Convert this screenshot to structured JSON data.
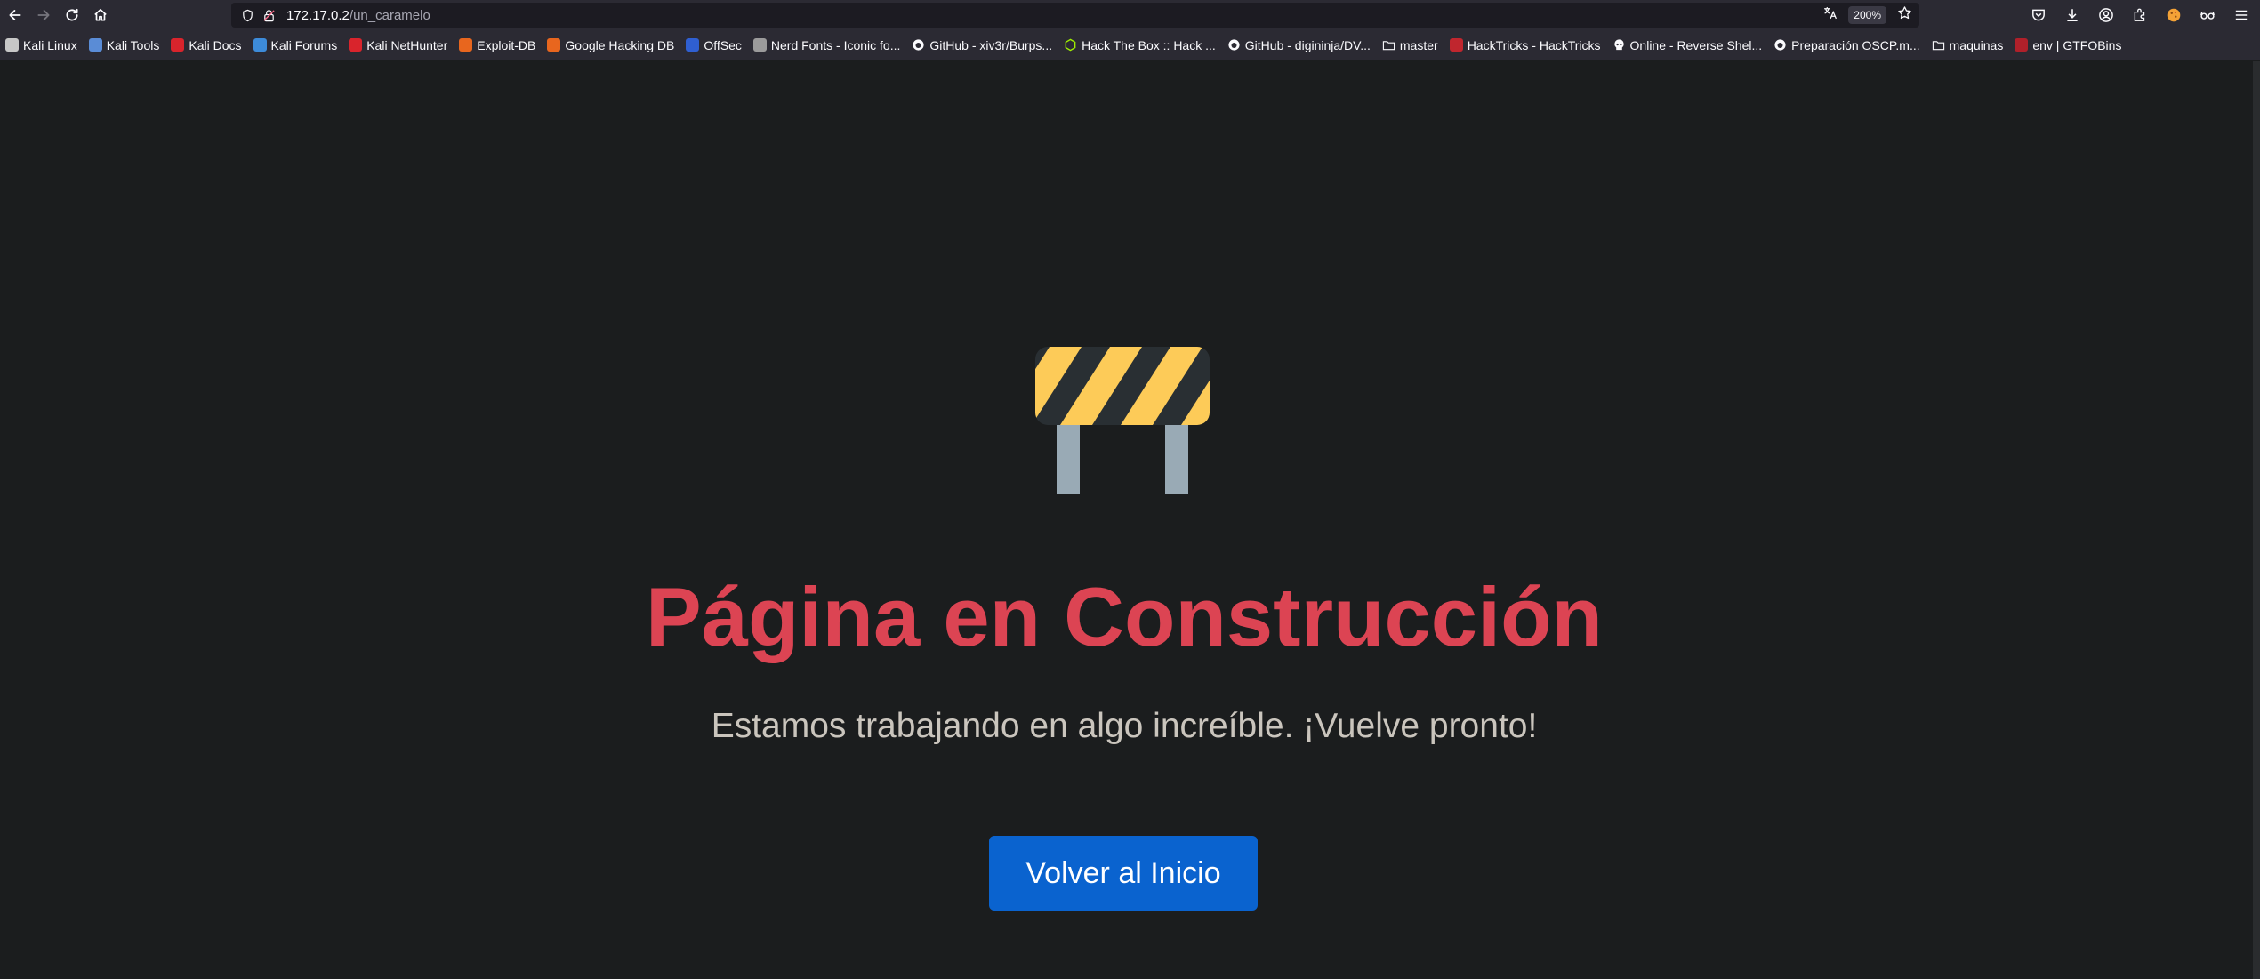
{
  "browser": {
    "url_host": "172.17.0.2",
    "url_path": "/un_caramelo",
    "zoom": "200%"
  },
  "bookmarks": [
    {
      "label": "Kali Linux",
      "icon": "kali-icon",
      "color": "#c7c7c7"
    },
    {
      "label": "Kali Tools",
      "icon": "kali-tools-icon",
      "color": "#5a8cd6"
    },
    {
      "label": "Kali Docs",
      "icon": "kali-docs-icon",
      "color": "#d9242c"
    },
    {
      "label": "Kali Forums",
      "icon": "kali-forums-icon",
      "color": "#3d8bd9"
    },
    {
      "label": "Kali NetHunter",
      "icon": "nethunter-icon",
      "color": "#d9242c"
    },
    {
      "label": "Exploit-DB",
      "icon": "exploit-db-icon",
      "color": "#e8661e"
    },
    {
      "label": "Google Hacking DB",
      "icon": "ghdb-icon",
      "color": "#e8661e"
    },
    {
      "label": "OffSec",
      "icon": "offsec-icon",
      "color": "#2f5fd1"
    },
    {
      "label": "Nerd Fonts - Iconic fo...",
      "icon": "nerd-fonts-icon",
      "color": "#9b9b9b"
    },
    {
      "label": "GitHub - xiv3r/Burps...",
      "icon": "github-icon",
      "color": "#e8e8e8"
    },
    {
      "label": "Hack The Box :: Hack ...",
      "icon": "hackthebox-icon",
      "color": "#9fef00"
    },
    {
      "label": "GitHub - digininja/DV...",
      "icon": "github-icon",
      "color": "#e8e8e8"
    },
    {
      "label": "master",
      "icon": "folder-icon",
      "color": "#e8e8e8"
    },
    {
      "label": "HackTricks - HackTricks",
      "icon": "hacktricks-icon",
      "color": "#c0262e"
    },
    {
      "label": "Online - Reverse Shel...",
      "icon": "skull-icon",
      "color": "#e8e8e8"
    },
    {
      "label": "Preparación OSCP.m...",
      "icon": "github-icon",
      "color": "#e8e8e8"
    },
    {
      "label": "maquinas",
      "icon": "folder-icon",
      "color": "#e8e8e8"
    },
    {
      "label": "env | GTFOBins",
      "icon": "gtfobins-icon",
      "color": "#b0202a"
    }
  ],
  "page": {
    "title": "Página en Construcción",
    "subtitle": "Estamos trabajando en algo increíble. ¡Vuelve pronto!",
    "button_label": "Volver al Inicio",
    "barrier_icon": "construction-barrier-icon"
  },
  "colors": {
    "title": "#dc4453",
    "button": "#0a63cf",
    "background": "#1b1d1e",
    "stripe_yellow": "#fdcb58",
    "stripe_dark": "#292f33",
    "post_gray": "#99aab5"
  }
}
